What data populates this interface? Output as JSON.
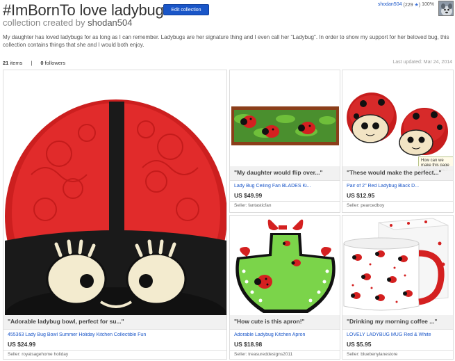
{
  "header": {
    "title": "#ImBornTo love ladybugs",
    "edit_button": "Edit collection",
    "created_prefix": "collection created by",
    "owner": "shodan504"
  },
  "user": {
    "name": "shodan504",
    "feedback_open": "(229",
    "star": "★",
    "feedback_close": ")",
    "percent": "100%"
  },
  "description": "My daughter has loved ladybugs for as long as I can remember. Ladybugs are her signature thing and I even call her \"Ladybug\". In order to show my support for her beloved bug, this collection contains things that she and I would both enjoy.",
  "stats": {
    "items_count": "21",
    "items_label": "items",
    "separator": "|",
    "followers_count": "0",
    "followers_label": "followers",
    "last_updated": "Last updated: Mar 24, 2014"
  },
  "tooltip": {
    "text": "How can we make this page better for you?"
  },
  "items": [
    {
      "quote": "\"Adorable ladybug bowl, perfect for su...\"",
      "title": "455363 Lady Bug Bowl Summer Holiday Kitchen Collectible Fun",
      "price": "US $24.99",
      "seller": "Seller: royalsagehome holiday"
    },
    {
      "quote": "\"My daughter would flip over...\"",
      "title": "Lady Bug Ceiling Fan BLADES Ki...",
      "price": "US $49.99",
      "seller": "Seller: fantasticfan"
    },
    {
      "quote": "\"These would make the perfect...\"",
      "title": "Pair of 2\" Red Ladybug Black D...",
      "price": "US $12.95",
      "seller": "Seller: pearcedboy"
    },
    {
      "quote": "\"How cute is this apron!\"",
      "title": "Adorable Ladybug Kitchen Apron",
      "price": "US $18.98",
      "seller": "Seller: treasureddesigns2011"
    },
    {
      "quote": "\"Drinking my morning coffee ...\"",
      "title": "LOVELY LADYBUG MUG Red & White",
      "price": "US $5.95",
      "seller": "Seller: bluebenylanestore"
    }
  ]
}
